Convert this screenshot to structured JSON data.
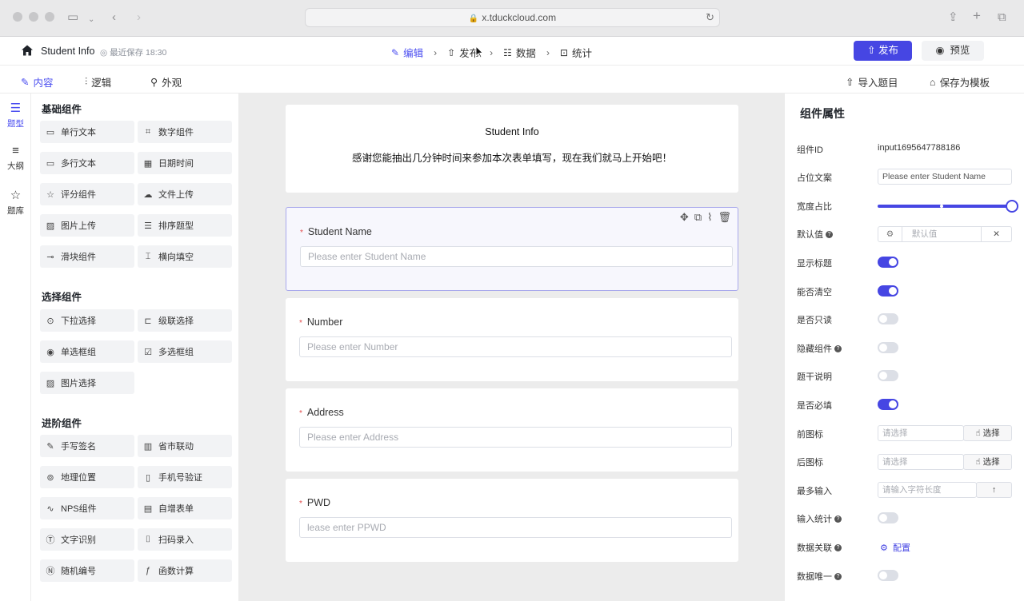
{
  "browser": {
    "url": "x.tduckcloud.com"
  },
  "app": {
    "title": "Student Info",
    "save_status": "最近保存 18:30",
    "steps": [
      {
        "label": "编辑",
        "icon": "edit-icon"
      },
      {
        "label": "发布",
        "icon": "publish-icon"
      },
      {
        "label": "数据",
        "icon": "data-icon"
      },
      {
        "label": "统计",
        "icon": "stats-icon"
      }
    ],
    "publish_label": "发布",
    "preview_label": "预览"
  },
  "subbar": {
    "tabs": [
      "内容",
      "逻辑",
      "外观"
    ],
    "import_label": "导入题目",
    "save_template_label": "保存为模板"
  },
  "rail": [
    "题型",
    "大纲",
    "题库"
  ],
  "components": {
    "basic_title": "基础组件",
    "basic": [
      "单行文本",
      "数字组件",
      "多行文本",
      "日期时间",
      "评分组件",
      "文件上传",
      "图片上传",
      "排序题型",
      "滑块组件",
      "横向填空"
    ],
    "choice_title": "选择组件",
    "choice": [
      "下拉选择",
      "级联选择",
      "单选框组",
      "多选框组",
      "图片选择"
    ],
    "advanced_title": "进阶组件",
    "advanced": [
      "手写签名",
      "省市联动",
      "地理位置",
      "手机号验证",
      "NPS组件",
      "自增表单",
      "文字识别",
      "扫码录入",
      "随机编号",
      "函数计算"
    ]
  },
  "form": {
    "title": "Student Info",
    "description": "感谢您能抽出几分钟时间来参加本次表单填写，现在我们就马上开始吧！",
    "fields": [
      {
        "label": "Student Name",
        "placeholder": "Please enter Student Name",
        "required": "*"
      },
      {
        "label": "Number",
        "placeholder": "Please enter Number",
        "required": "*"
      },
      {
        "label": "Address",
        "placeholder": "Please enter Address",
        "required": "*"
      },
      {
        "label": "PWD",
        "placeholder": "lease enter PPWD",
        "required": "*"
      }
    ]
  },
  "props": {
    "title": "组件属性",
    "component_id_label": "组件ID",
    "component_id": "input1695647788186",
    "placeholder_label": "占位文案",
    "placeholder_value": "Please enter Student Name",
    "width_label": "宽度占比",
    "width_ratio": 1.0,
    "default_label": "默认值",
    "default_placeholder": "默认值",
    "show_title_label": "显示标题",
    "show_title": true,
    "clearable_label": "能否清空",
    "clearable": true,
    "readonly_label": "是否只读",
    "readonly": false,
    "hidden_label": "隐藏组件",
    "hidden": false,
    "desc_label": "题干说明",
    "desc": false,
    "required_label": "是否必填",
    "required": true,
    "prefix_icon_label": "前图标",
    "suffix_icon_label": "后图标",
    "select_placeholder": "请选择",
    "select_button": "选择",
    "maxlen_label": "最多输入",
    "maxlen_placeholder": "请输入字符长度",
    "count_label": "输入统计",
    "count": false,
    "relation_label": "数据关联",
    "relation_button": "配置",
    "unique_label": "数据唯一",
    "unique": false
  }
}
